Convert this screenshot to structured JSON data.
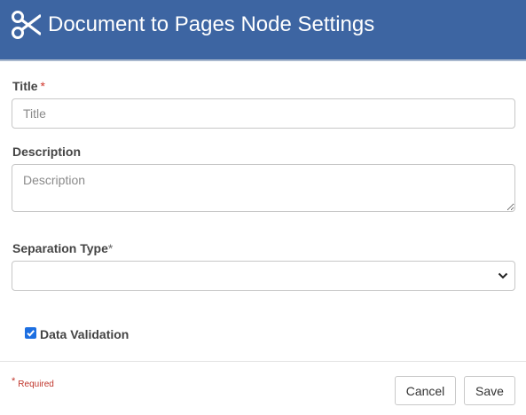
{
  "dialog": {
    "title": "Document to Pages Node Settings",
    "icon": "scissors-icon"
  },
  "form": {
    "title_label": "Title",
    "title_required_mark": "*",
    "title_placeholder": "Title",
    "title_value": "",
    "description_label": "Description",
    "description_placeholder": "Description",
    "description_value": "",
    "separation_type_label": "Separation Type",
    "separation_type_required_mark": "*",
    "separation_type_selected": "",
    "data_validation_label": "Data Validation",
    "data_validation_checked": true
  },
  "footer": {
    "required_mark": "*",
    "required_note": "Required",
    "cancel_label": "Cancel",
    "save_label": "Save"
  },
  "colors": {
    "header_bg": "#3d65a2",
    "required": "#d0352b",
    "checkbox": "#1d6fe1"
  }
}
